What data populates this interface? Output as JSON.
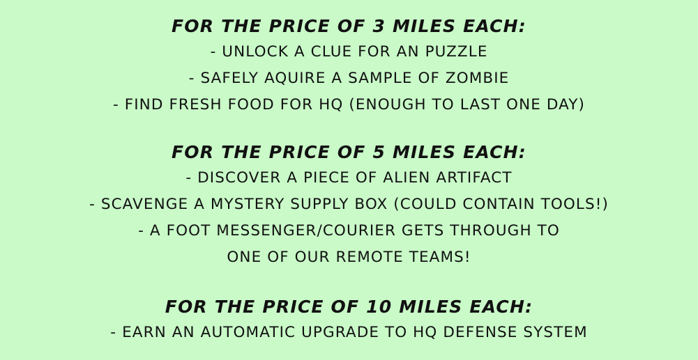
{
  "sections": [
    {
      "heading": "For the price of 3 miles each:",
      "items": [
        "- Unlock a clue for an puzzle",
        "- Safely aquire a sample of zombie",
        "- Find fresh food for HQ (enough to last one day)"
      ]
    },
    {
      "heading": "For the price of 5 miles each:",
      "items": [
        "- Discover a piece of alien artifact",
        "- Scavenge a mystery supply box (could contain tools!)",
        "- A foot messenger/courier gets through to",
        "one of our remote teams!"
      ]
    },
    {
      "heading": "For the price of 10 miles each:",
      "items": [
        "- Earn an automatic upgrade to HQ defense system"
      ]
    }
  ],
  "colors": {
    "background": "#c9fac8",
    "text": "#111111"
  }
}
